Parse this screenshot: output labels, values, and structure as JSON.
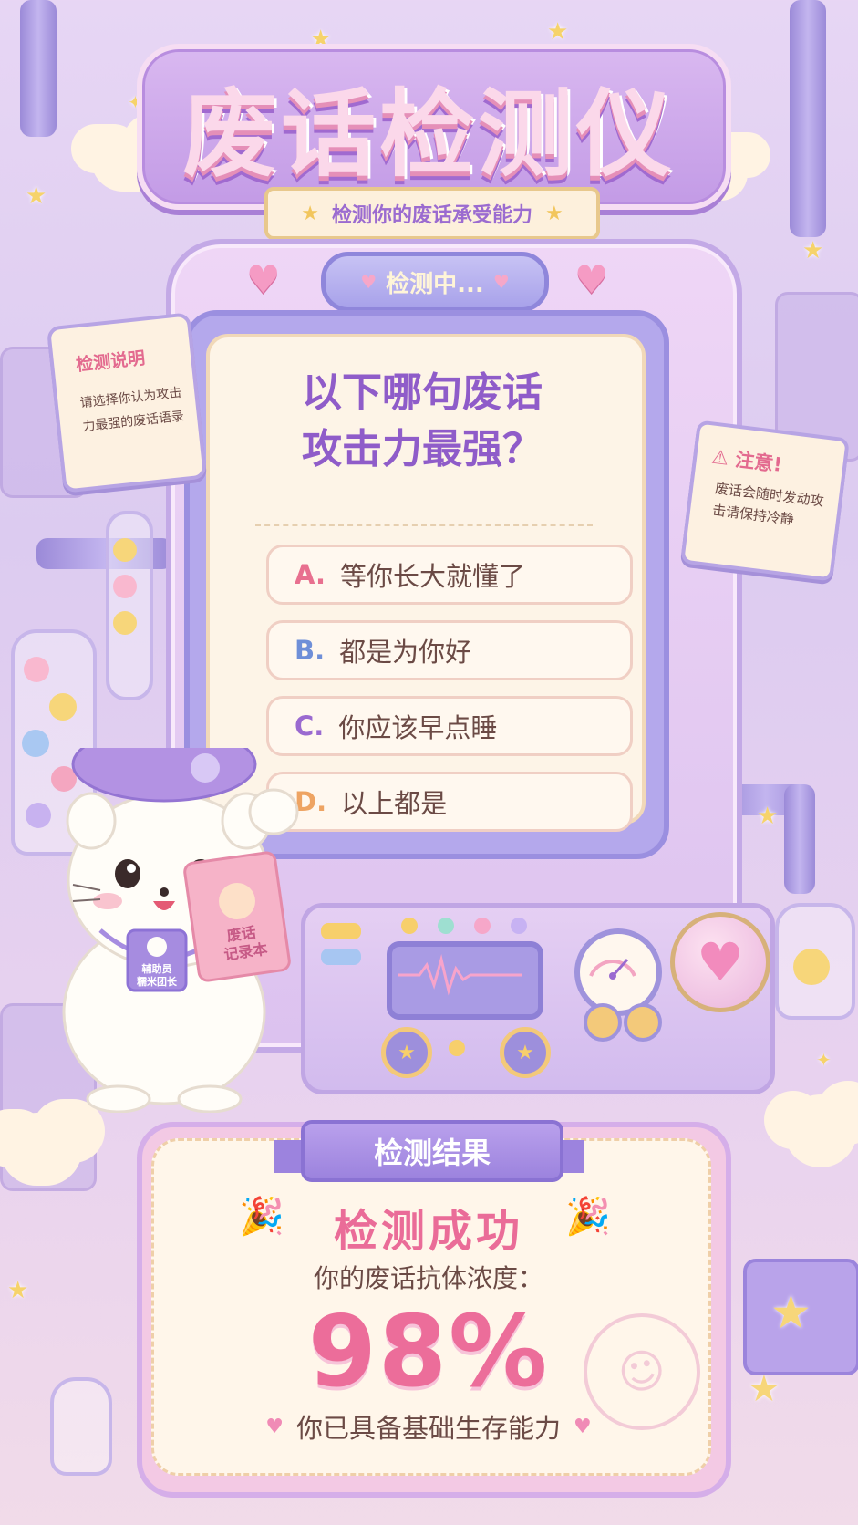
{
  "header": {
    "title": "废话检测仪",
    "subtitle": "检测你的废话承受能力"
  },
  "machine": {
    "status": "检测中..."
  },
  "question": {
    "line1": "以下哪句废话",
    "line2": "攻击力最强？",
    "options": [
      {
        "letter": "A.",
        "text": "等你长大就懂了",
        "color": "#e8708f"
      },
      {
        "letter": "B.",
        "text": "都是为你好",
        "color": "#6f8fd8"
      },
      {
        "letter": "C.",
        "text": "你应该早点睡",
        "color": "#9a6ad0"
      },
      {
        "letter": "D.",
        "text": "以上都是",
        "color": "#eea463"
      }
    ]
  },
  "note_left": {
    "title": "检测说明",
    "body": "请选择你认为攻击力最强的废话语录"
  },
  "note_right": {
    "title": "⚠ 注意!",
    "body": "废话会随时发动攻击请保持冷静"
  },
  "mascot": {
    "badge_line1": "辅助员",
    "badge_line2": "糯米团长",
    "book_line1": "废话",
    "book_line2": "记录本"
  },
  "result": {
    "ribbon": "检测结果",
    "headline": "检测成功",
    "label": "你的废话抗体浓度：",
    "percent": "98%",
    "verdict": "你已具备基础生存能力"
  }
}
